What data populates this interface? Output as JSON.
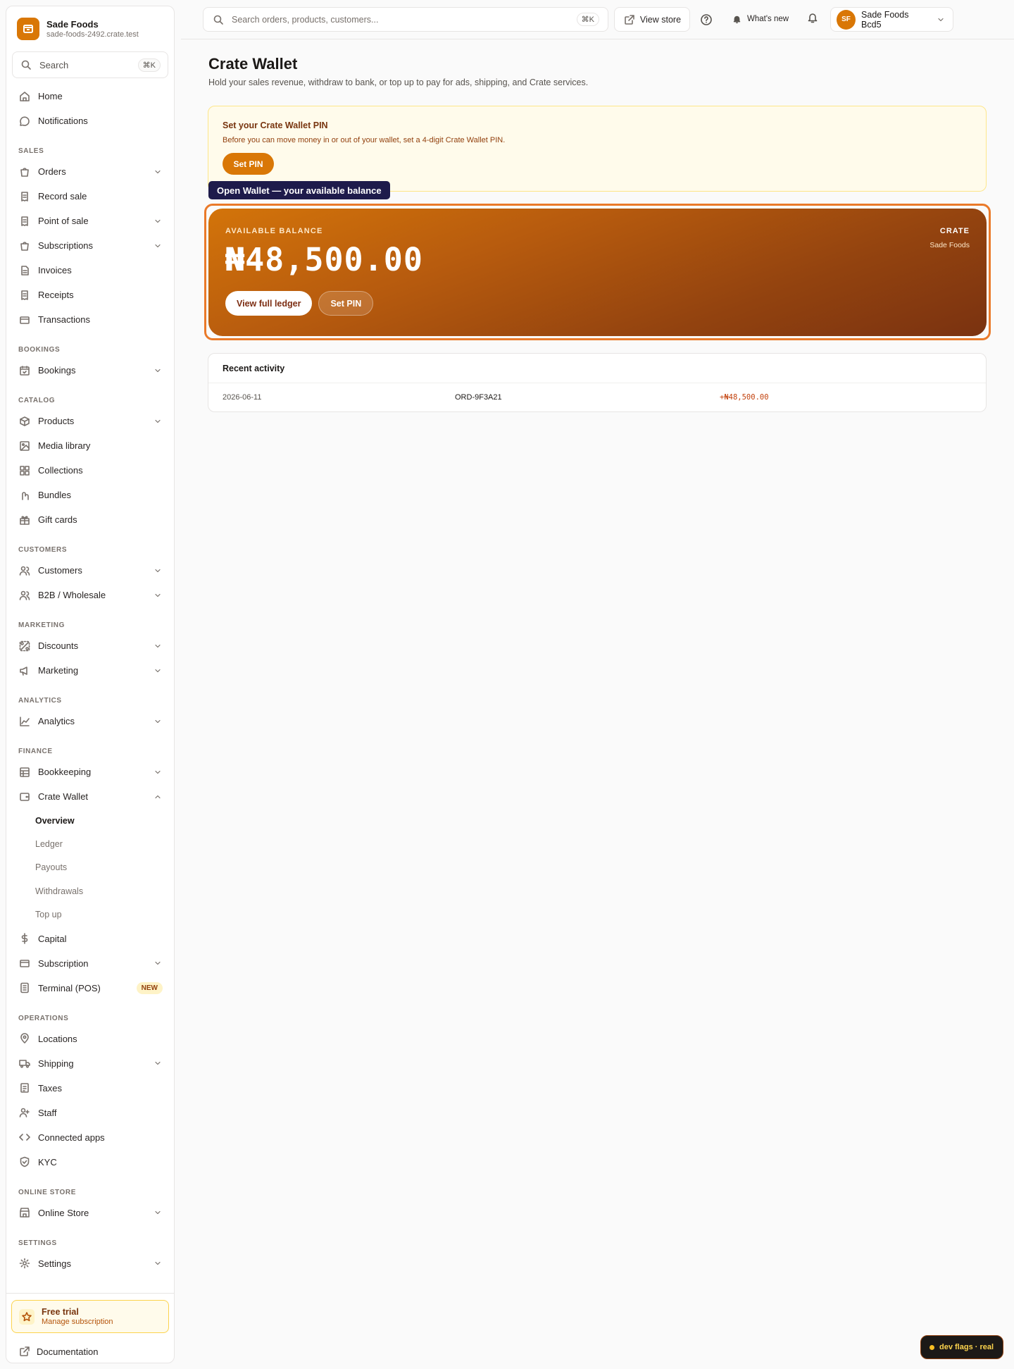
{
  "brand": {
    "name": "Sade Foods",
    "domain": "sade-foods-2492.crate.test"
  },
  "sidebar": {
    "search_label": "Search",
    "search_kbd": "⌘K",
    "top_items": [
      {
        "label": "Home",
        "icon": "home-icon"
      },
      {
        "label": "Notifications",
        "icon": "chat-icon"
      }
    ],
    "sections": [
      {
        "title": "SALES",
        "items": [
          {
            "label": "Orders",
            "icon": "bag-icon",
            "chevron": true
          },
          {
            "label": "Record sale",
            "icon": "receipt-icon"
          },
          {
            "label": "Point of sale",
            "icon": "receipt-icon",
            "chevron": true
          },
          {
            "label": "Subscriptions",
            "icon": "bag-icon",
            "chevron": true
          },
          {
            "label": "Invoices",
            "icon": "doc-icon"
          },
          {
            "label": "Receipts",
            "icon": "receipt-icon"
          },
          {
            "label": "Transactions",
            "icon": "card-icon"
          }
        ]
      },
      {
        "title": "BOOKINGS",
        "items": [
          {
            "label": "Bookings",
            "icon": "calendar-icon",
            "chevron": true
          }
        ]
      },
      {
        "title": "CATALOG",
        "items": [
          {
            "label": "Products",
            "icon": "box-icon",
            "chevron": true
          },
          {
            "label": "Media library",
            "icon": "image-icon"
          },
          {
            "label": "Collections",
            "icon": "grid-icon"
          },
          {
            "label": "Bundles",
            "icon": "bundle-icon"
          },
          {
            "label": "Gift cards",
            "icon": "gift-icon"
          }
        ]
      },
      {
        "title": "CUSTOMERS",
        "items": [
          {
            "label": "Customers",
            "icon": "users-icon",
            "chevron": true
          },
          {
            "label": "B2B / Wholesale",
            "icon": "users-icon",
            "chevron": true
          }
        ]
      },
      {
        "title": "MARKETING",
        "items": [
          {
            "label": "Discounts",
            "icon": "discount-icon",
            "chevron": true
          },
          {
            "label": "Marketing",
            "icon": "megaphone-icon",
            "chevron": true
          }
        ]
      },
      {
        "title": "ANALYTICS",
        "items": [
          {
            "label": "Analytics",
            "icon": "chart-icon",
            "chevron": true
          }
        ]
      }
    ],
    "finance_title": "FINANCE",
    "bookkeeping": "Bookkeeping",
    "crate_wallet": "Crate Wallet",
    "wallet_subitems": [
      "Overview",
      "Ledger",
      "Payouts",
      "Withdrawals",
      "Top up"
    ],
    "capital": "Capital",
    "subscription": "Subscription",
    "terminal": "Terminal (POS)",
    "new_badge": "NEW",
    "operations_title": "OPERATIONS",
    "operations": [
      "Locations",
      "Shipping",
      "Taxes",
      "Staff",
      "Connected apps",
      "KYC"
    ],
    "online_store_title": "ONLINE STORE",
    "online_store": "Online Store",
    "settings_title": "SETTINGS",
    "settings": "Settings",
    "trial_title": "Free trial",
    "trial_sub": "Manage subscription",
    "documentation": "Documentation"
  },
  "topbar": {
    "search_placeholder": "Search orders, products, customers...",
    "search_kbd": "⌘K",
    "view_store": "View store",
    "whats_new": "What's new",
    "avatar_initials": "SF",
    "account_name": "Sade Foods Bcd5"
  },
  "main": {
    "title": "Crate Wallet",
    "subtitle": "Hold your sales revenue, withdraw to bank, or top up to pay for ads, shipping, and Crate services.",
    "pin_banner": {
      "title": "Set your Crate Wallet PIN",
      "desc": "Before you can move money in or out of your wallet, set a 4-digit Crate Wallet PIN.",
      "button": "Set PIN"
    },
    "tooltip": "Open Wallet — your available balance",
    "card": {
      "label": "AVAILABLE BALANCE",
      "amount": "₦48,500.00",
      "ledger_button": "View full ledger",
      "pin_button": "Set PIN",
      "brand": "CRATE",
      "store": "Sade Foods"
    },
    "activity": {
      "title": "Recent activity",
      "rows": [
        {
          "date": "2026-06-11",
          "ref": "ORD-9F3A21",
          "amount": "+₦48,500.00"
        }
      ]
    }
  },
  "dev_flags": "dev flags · real",
  "colors": {
    "accent": "#d97706",
    "accent_dark": "#7a3210",
    "tooltip": "#1e1b4b"
  }
}
